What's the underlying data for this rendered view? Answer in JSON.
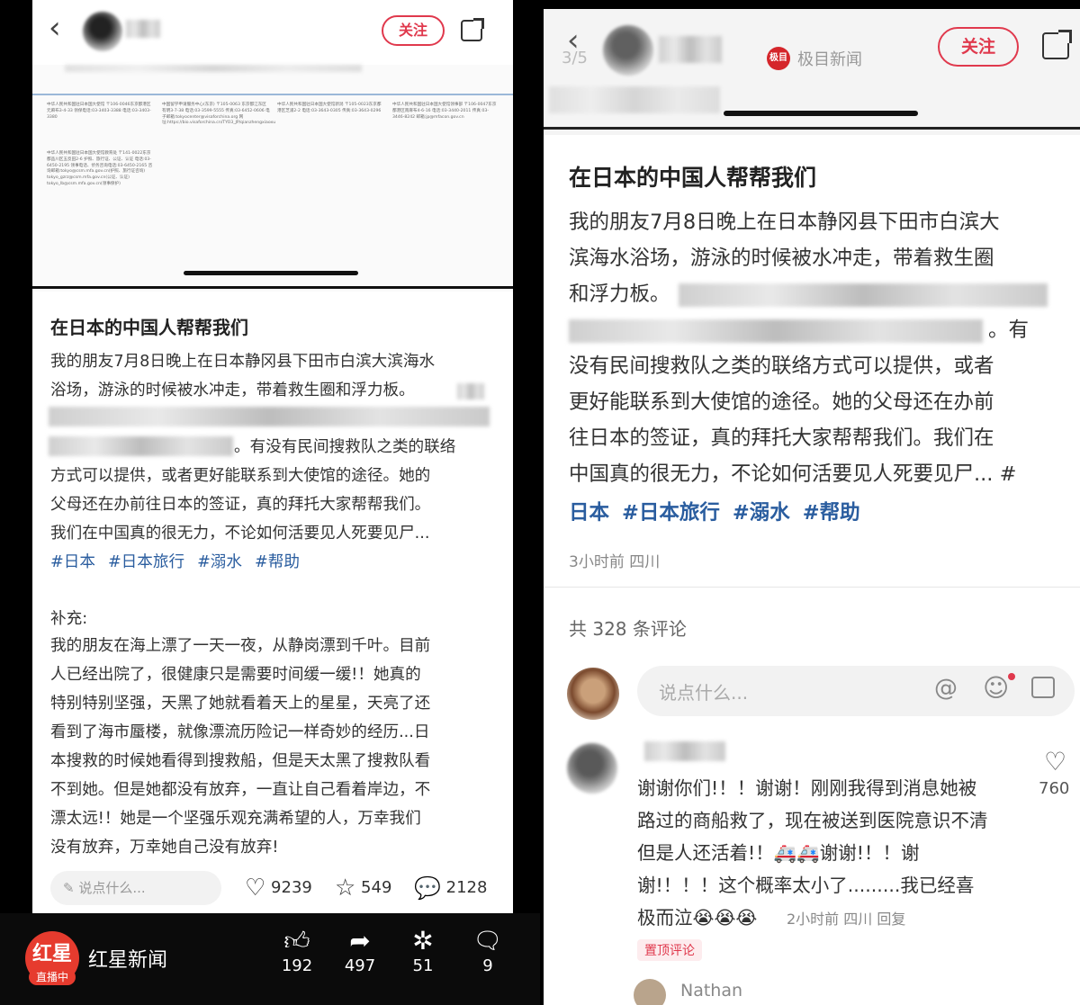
{
  "left": {
    "header": {
      "back_icon": "‹",
      "follow_label": "关注"
    },
    "doc_blocks": [
      "中华人民共和国驻日本国大使馆 〒106-0046东京都港区元麻布3-4-33 领保电话:03-3403-3388 电话:03-3403-3380",
      "中国留学申请服务中心(东京) 〒105-0063 东京都江东区有明3-7-38 电话:03-3599-5555 传真:03-6452-0606 电子邮箱:tokyocenter@visaforchina.org 网址:https://bio.visaforchina.cn/TYO3_JP/qianzhengxiaoxu",
      "中华人民共和国驻日本国大使馆新潟 〒105-0023东京都港区芝浦2-2 电话:03-3643-0305 传真:03-3643-0296",
      "中华人民共和国驻日本国大使馆领事部 〒106-0047东京都港区南麻布4-6-16 电话:03-3440-2011 传真:03-3446-8242 邮箱:jp@mfacon.gov.cn",
      "中华人民共和国驻日本国大使馆教育处 〒141-0022东京都品川区五反田2-6 护照、旅行证、公证、认证 电话:03-6450-2195 领事电话、侨务咨询电话:03-6450-2165 咨询邮箱:tokyo@csm.mfa.gov.cn(护照、旅行证咨询) tokyo_gzrz@csm.mfa.gov.cn(公证、认证) tokyo_lb@csm.mfa.gov.cn(领事保护)"
    ],
    "post": {
      "title": "在日本的中国人帮帮我们",
      "line1": "我的朋友7月8日晚上在日本静冈县下田市白滨大滨海水",
      "line2": "浴场，游泳的时候被水冲走，带着救生圈和浮力板。",
      "line3b": "。有没有民间搜救队之类的联络",
      "line4": "方式可以提供，或者更好能联系到大使馆的途径。她的",
      "line5": "父母还在办前往日本的签证，真的拜托大家帮帮我们。",
      "line6": "我们在中国真的很无力，不论如何活要见人死要见尸...",
      "tags": [
        "#日本",
        "#日本旅行",
        "#溺水",
        "#帮助"
      ],
      "supp_label": "补充:",
      "supp": [
        "我的朋友在海上漂了一天一夜，从静岗漂到千叶。目前",
        "人已经出院了，很健康只是需要时间缓一缓!！她真的",
        "特别特别坚强，天黑了她就看着天上的星星，天亮了还",
        "看到了海市蜃楼，就像漂流历险记一样奇妙的经历...日",
        "本搜救的时候她看得到搜救船，但是天太黑了搜救队看",
        "不到她。但是她都没有放弃，一直让自己看着岸边，不",
        "漂太远!！她是一个坚强乐观充满希望的人，万幸我们",
        "没有放弃，万幸她自己没有放弃!"
      ]
    },
    "action_bar": {
      "comment_placeholder": "说点什么...",
      "likes": "9239",
      "stars": "549",
      "comments": "2128"
    }
  },
  "left_footer": {
    "logo_text": "红星",
    "live_badge": "直播中",
    "brand": "红星新闻",
    "likes": "192",
    "shares": "497",
    "gifts": "51",
    "comments": "9"
  },
  "right": {
    "header": {
      "back_icon": "‹",
      "page": "3/5",
      "watermark_logo": "极目",
      "watermark_text": "极目新闻",
      "follow_label": "关注"
    },
    "post": {
      "title": "在日本的中国人帮帮我们",
      "lines": [
        "我的朋友7月8日晚上在日本静冈县下田市白滨大",
        "滨海水浴场，游泳的时候被水冲走，带着救生圈",
        "和浮力板。"
      ],
      "line4b": "。有",
      "lines2": [
        "没有民间搜救队之类的联络方式可以提供，或者",
        "更好能联系到大使馆的途径。她的父母还在办前",
        "往日本的签证，真的拜托大家帮帮我们。我们在",
        "中国真的很无力，不论如何活要见人死要见尸... #"
      ],
      "tags": [
        "日本",
        "#日本旅行",
        "#溺水",
        "#帮助"
      ],
      "meta": "3小时前 四川",
      "comment_count": "共 328 条评论",
      "input_placeholder": "说点什么..."
    },
    "comment": {
      "lines": [
        "谢谢你们!！！谢谢！刚刚我得到消息她被",
        "路过的商船救了，现在被送到医院意识不清",
        "但是人还活着!！🚑🚑谢谢!！！谢",
        "谢!！！！这个概率太小了.........我已经喜",
        "极而泣😭😭😭"
      ],
      "time": "2小时前 四川 回复",
      "like_count": "760",
      "pinned": "置顶评论"
    },
    "next_user": "Nathan"
  },
  "colors": {
    "accent": "#e0394d",
    "tag": "#2a5d9f",
    "brand_red": "#e63b2e"
  }
}
